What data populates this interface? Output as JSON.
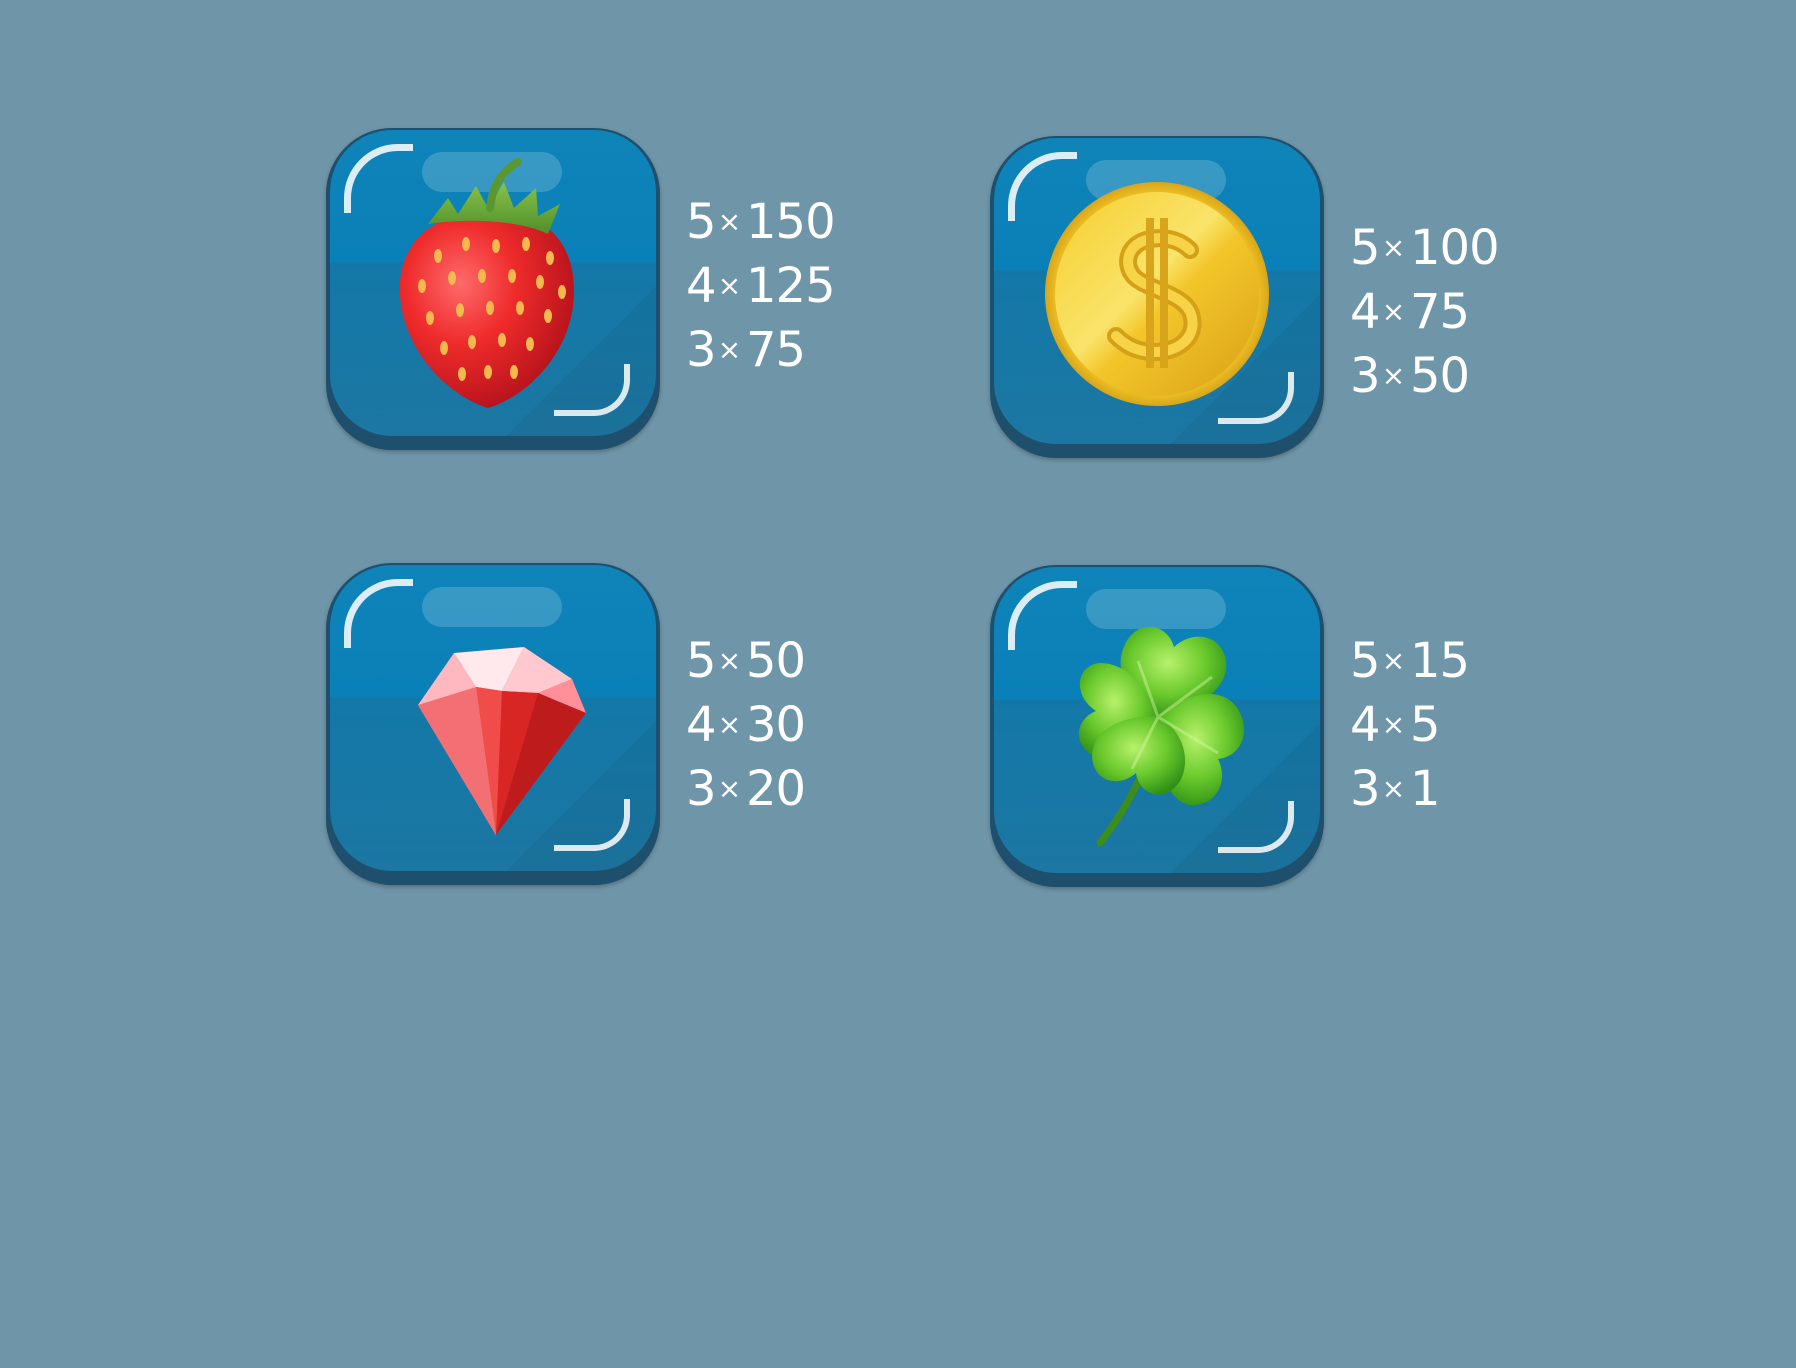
{
  "symbols": [
    {
      "icon": "strawberry-icon",
      "payouts": [
        {
          "count": "5",
          "times": "×",
          "value": "150"
        },
        {
          "count": "4",
          "times": "×",
          "value": "125"
        },
        {
          "count": "3",
          "times": "×",
          "value": "75"
        }
      ]
    },
    {
      "icon": "gold-coin-icon",
      "payouts": [
        {
          "count": "5",
          "times": "×",
          "value": "100"
        },
        {
          "count": "4",
          "times": "×",
          "value": "75"
        },
        {
          "count": "3",
          "times": "×",
          "value": "50"
        }
      ]
    },
    {
      "icon": "ruby-gem-icon",
      "payouts": [
        {
          "count": "5",
          "times": "×",
          "value": "50"
        },
        {
          "count": "4",
          "times": "×",
          "value": "30"
        },
        {
          "count": "3",
          "times": "×",
          "value": "20"
        }
      ]
    },
    {
      "icon": "four-leaf-clover-icon",
      "payouts": [
        {
          "count": "5",
          "times": "×",
          "value": "15"
        },
        {
          "count": "4",
          "times": "×",
          "value": "5"
        },
        {
          "count": "3",
          "times": "×",
          "value": "1"
        }
      ]
    }
  ],
  "colors": {
    "background": "#6f95a8",
    "tile_top": "#0f84b9",
    "tile_bottom": "#1c77a2",
    "tile_border": "#1e4f6d",
    "text": "#ffffff"
  }
}
